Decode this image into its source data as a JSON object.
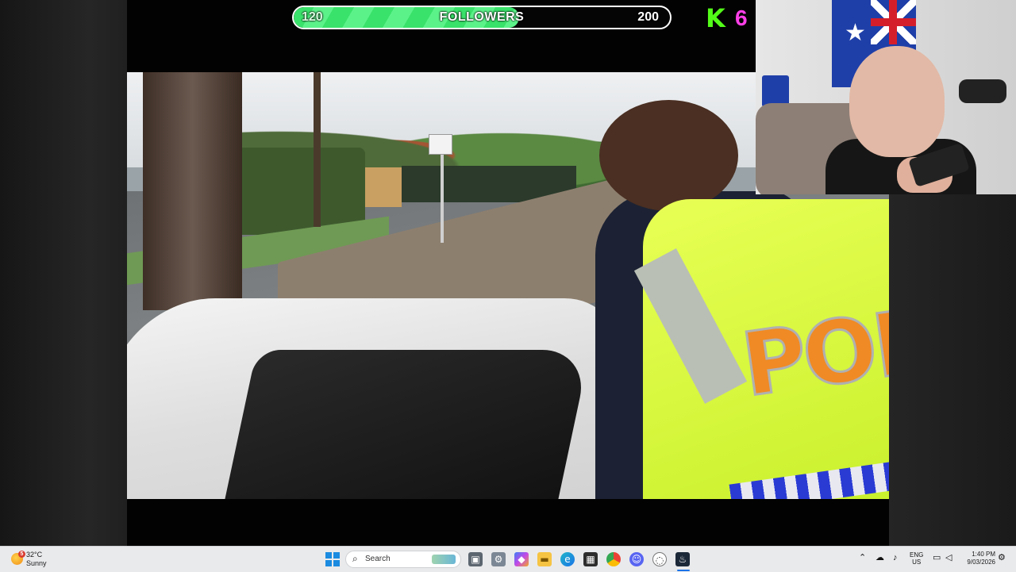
{
  "stream": {
    "goal": {
      "start": "120",
      "label": "FOLLOWERS",
      "end": "200",
      "progress_fraction": 0.6,
      "fill_color": "#39e26a"
    },
    "kick_logo": "K",
    "viewer_count": "6",
    "colors": {
      "kick_green": "#53fc18",
      "count_magenta": "#ff3fe8"
    }
  },
  "video": {
    "vest_text": "POL"
  },
  "taskbar": {
    "weather": {
      "badge": "5",
      "temp": "32°C",
      "condition": "Sunny"
    },
    "search": {
      "label": "Search"
    },
    "icons": [
      "start-icon",
      "search-icon",
      "file-explorer-icon",
      "settings-icon",
      "copilot-icon",
      "folder-icon",
      "edge-icon",
      "store-icon",
      "chrome-icon",
      "discord-icon",
      "app-icon",
      "steam-icon"
    ],
    "tray": {
      "lang_top": "ENG",
      "lang_bottom": "US",
      "time": "1:40 PM",
      "date": "9/03/2026"
    }
  }
}
